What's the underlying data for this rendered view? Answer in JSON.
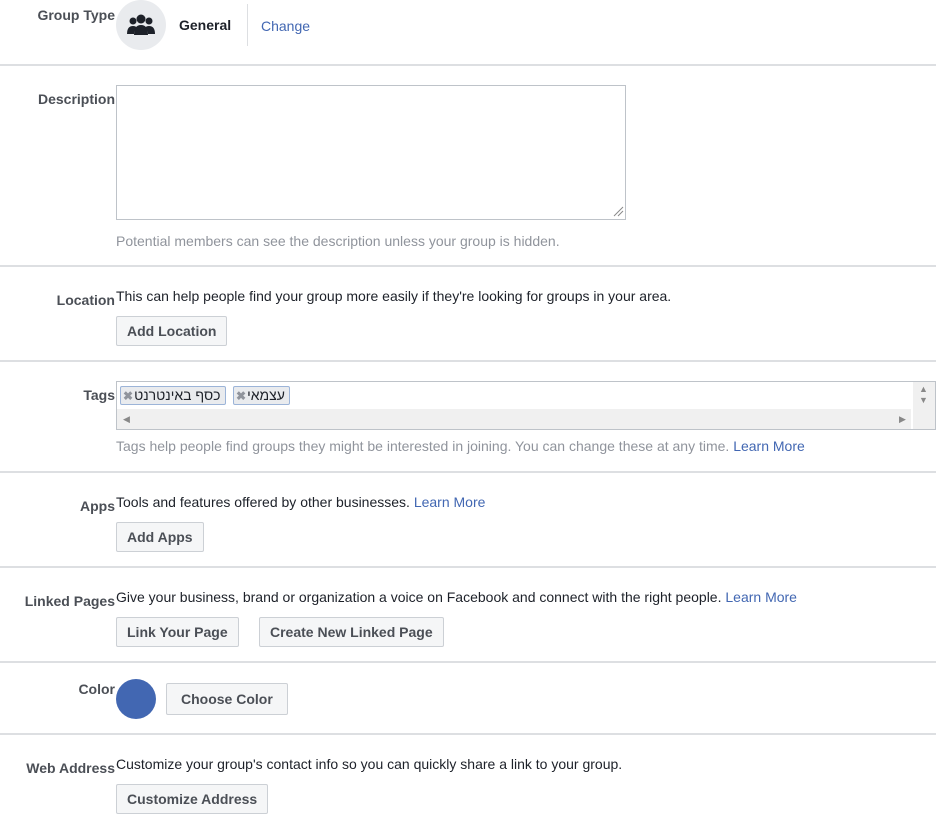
{
  "group_type": {
    "label": "Group Type",
    "value": "General",
    "change_link": "Change",
    "icon": "group-icon"
  },
  "description": {
    "label": "Description",
    "value": "",
    "hint": "Potential members can see the description unless your group is hidden."
  },
  "location": {
    "label": "Location",
    "text": "This can help people find your group more easily if they're looking for groups in your area.",
    "button": "Add Location"
  },
  "tags": {
    "label": "Tags",
    "items": [
      "עצמאי",
      "כסף באינטרנט"
    ],
    "hint": "Tags help people find groups they might be interested in joining. You can change these at any time.",
    "learn_more": "Learn More"
  },
  "apps": {
    "label": "Apps",
    "text": "Tools and features offered by other businesses.",
    "learn_more": "Learn More",
    "button": "Add Apps"
  },
  "linked_pages": {
    "label": "Linked Pages",
    "text": "Give your business, brand or organization a voice on Facebook and connect with the right people.",
    "learn_more": "Learn More",
    "button_link": "Link Your Page",
    "button_create": "Create New Linked Page"
  },
  "color": {
    "label": "Color",
    "value": "#4267b2",
    "button": "Choose Color"
  },
  "web_address": {
    "label": "Web Address",
    "text": "Customize your group's contact info so you can quickly share a link to your group.",
    "button": "Customize Address"
  }
}
